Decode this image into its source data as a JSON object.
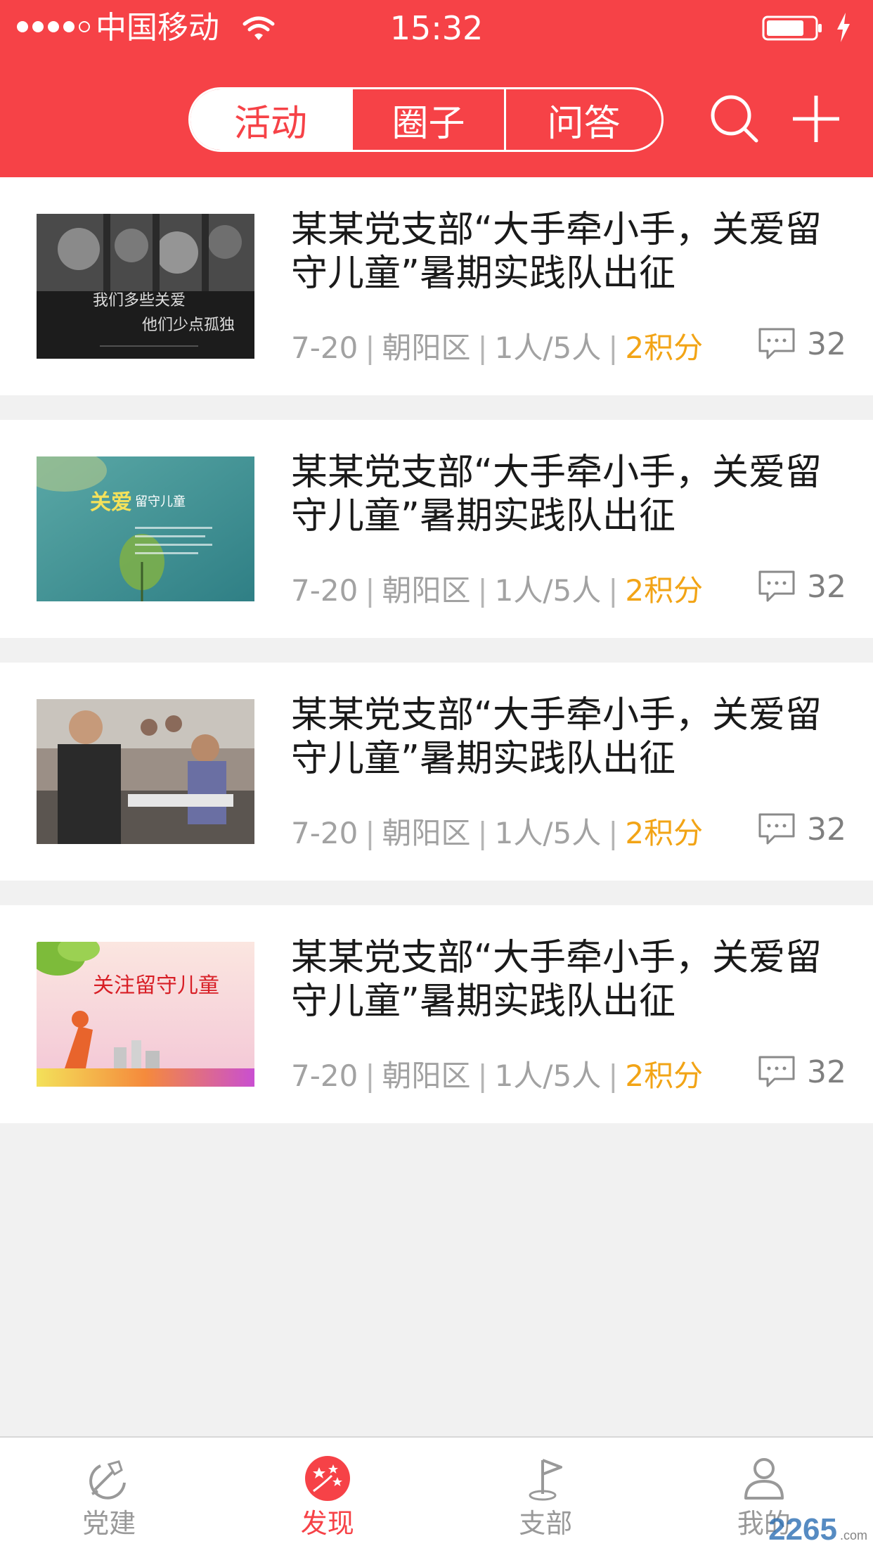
{
  "status_bar": {
    "carrier": "中国移动",
    "time": "15:32"
  },
  "nav": {
    "tabs": [
      {
        "label": "活动",
        "active": true
      },
      {
        "label": "圈子",
        "active": false
      },
      {
        "label": "问答",
        "active": false
      }
    ],
    "search_icon": "search-icon",
    "add_icon": "plus-icon"
  },
  "colors": {
    "brand": "#f64247",
    "points": "#f2a416"
  },
  "items": [
    {
      "title": "某某党支部“大手牵小手，关爱留守儿童”暑期实践队出征",
      "date": "7-20",
      "district": "朝阳区",
      "participants": "1人/5人",
      "points": "2积分",
      "comments": "32",
      "image_text": [
        "我们多些关爱",
        "他们少点孤独"
      ]
    },
    {
      "title": "某某党支部“大手牵小手，关爱留守儿童”暑期实践队出征",
      "date": "7-20",
      "district": "朝阳区",
      "participants": "1人/5人",
      "points": "2积分",
      "comments": "32",
      "image_text": [
        "关爱",
        "留守儿童"
      ]
    },
    {
      "title": "某某党支部“大手牵小手，关爱留守儿童”暑期实践队出征",
      "date": "7-20",
      "district": "朝阳区",
      "participants": "1人/5人",
      "points": "2积分",
      "comments": "32",
      "image_text": []
    },
    {
      "title": "某某党支部“大手牵小手，关爱留守儿童”暑期实践队出征",
      "date": "7-20",
      "district": "朝阳区",
      "participants": "1人/5人",
      "points": "2积分",
      "comments": "32",
      "image_text": [
        "关注留守儿童"
      ]
    }
  ],
  "tab_bar": [
    {
      "label": "党建",
      "icon": "party-emblem-icon",
      "active": false
    },
    {
      "label": "发现",
      "icon": "discover-stars-icon",
      "active": true
    },
    {
      "label": "支部",
      "icon": "flag-icon",
      "active": false
    },
    {
      "label": "我的",
      "icon": "person-icon",
      "active": false
    }
  ],
  "watermark": {
    "text": "2265",
    "suffix": ".com"
  }
}
